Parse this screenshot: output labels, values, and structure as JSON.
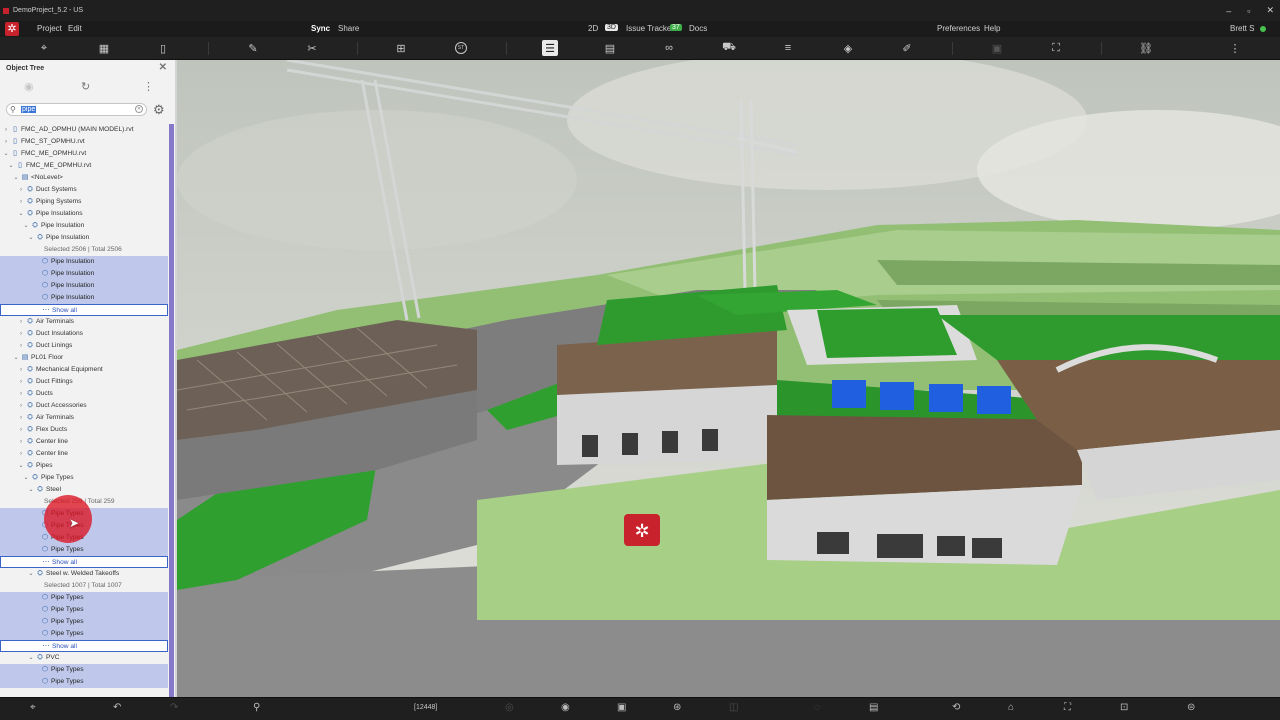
{
  "window": {
    "title": "DemoProject_5.2 - US",
    "controls": [
      "–",
      "▫",
      "✕"
    ]
  },
  "menubar": {
    "left": [
      "Project",
      "Edit"
    ],
    "sync": "Sync",
    "share": "Share",
    "view_2d": "2D",
    "view_3d": "3D",
    "issue_tracker": "Issue Tracker",
    "issue_count": "37",
    "docs": "Docs",
    "preferences": "Preferences",
    "help": "Help",
    "user": "Brett S"
  },
  "toolbar": {
    "icons": [
      "location-pin-icon",
      "map-icon",
      "mobile-icon",
      "ruler-icon",
      "scissors-icon",
      "add-square-icon",
      "st-circle-icon",
      "object-tree-icon",
      "list-icon",
      "binoculars-icon",
      "filter-truck-icon",
      "sort-list-icon",
      "paint-bucket-icon",
      "edit-doc-icon",
      "layers-icon",
      "drone-icon",
      "link-icon",
      "more-icon"
    ],
    "st_label": "ST",
    "active": "object-tree-icon"
  },
  "panel": {
    "title": "Object Tree",
    "search_value": "pipe",
    "tree": [
      {
        "label": "FMC_AD_OPMHU (MAIN MODEL).rvt",
        "indent": 0,
        "chev": "›",
        "icon": "file"
      },
      {
        "label": "FMC_ST_OPMHU.rvt",
        "indent": 0,
        "chev": "›",
        "icon": "file"
      },
      {
        "label": "FMC_ME_OPMHU.rvt",
        "indent": 0,
        "chev": "⌄",
        "icon": "file"
      },
      {
        "label": "FMC_ME_OPMHU.rvt",
        "indent": 1,
        "chev": "⌄",
        "icon": "doc"
      },
      {
        "label": "<NoLevel>",
        "indent": 2,
        "chev": "⌄",
        "icon": "level"
      },
      {
        "label": "Duct Systems",
        "indent": 3,
        "chev": "›",
        "icon": "type"
      },
      {
        "label": "Piping Systems",
        "indent": 3,
        "chev": "›",
        "icon": "type"
      },
      {
        "label": "Pipe Insulations",
        "indent": 3,
        "chev": "⌄",
        "icon": "type"
      },
      {
        "label": "Pipe Insulation",
        "indent": 4,
        "chev": "⌄",
        "icon": "type"
      },
      {
        "label": "Pipe Insulation",
        "indent": 5,
        "chev": "⌄",
        "icon": "type"
      },
      {
        "label": "Selected 2506 | Total 2506",
        "indent": 6,
        "kind": "selinfo"
      },
      {
        "label": "Pipe Insulation",
        "indent": 6,
        "kind": "hl",
        "icon": "cube"
      },
      {
        "label": "Pipe Insulation",
        "indent": 6,
        "kind": "hl",
        "icon": "cube"
      },
      {
        "label": "Pipe Insulation",
        "indent": 6,
        "kind": "hl",
        "icon": "cube"
      },
      {
        "label": "Pipe Insulation",
        "indent": 6,
        "kind": "hl",
        "icon": "cube"
      },
      {
        "label": "Show all",
        "indent": 6,
        "kind": "showall",
        "icon": "dots"
      },
      {
        "label": "Air Terminals",
        "indent": 3,
        "chev": "›",
        "icon": "type"
      },
      {
        "label": "Duct Insulations",
        "indent": 3,
        "chev": "›",
        "icon": "type"
      },
      {
        "label": "Duct Linings",
        "indent": 3,
        "chev": "›",
        "icon": "type"
      },
      {
        "label": "PL01 Floor",
        "indent": 2,
        "chev": "⌄",
        "icon": "level"
      },
      {
        "label": "Mechanical Equipment",
        "indent": 3,
        "chev": "›",
        "icon": "type"
      },
      {
        "label": "Duct Fittings",
        "indent": 3,
        "chev": "›",
        "icon": "type"
      },
      {
        "label": "Ducts",
        "indent": 3,
        "chev": "›",
        "icon": "type"
      },
      {
        "label": "Duct Accessories",
        "indent": 3,
        "chev": "›",
        "icon": "type"
      },
      {
        "label": "Air Terminals",
        "indent": 3,
        "chev": "›",
        "icon": "type"
      },
      {
        "label": "Flex Ducts",
        "indent": 3,
        "chev": "›",
        "icon": "type"
      },
      {
        "label": "Center line",
        "indent": 3,
        "chev": "›",
        "icon": "type"
      },
      {
        "label": "Center line",
        "indent": 3,
        "chev": "›",
        "icon": "type"
      },
      {
        "label": "Pipes",
        "indent": 3,
        "chev": "⌄",
        "icon": "type"
      },
      {
        "label": "Pipe Types",
        "indent": 4,
        "chev": "⌄",
        "icon": "type"
      },
      {
        "label": "Steel",
        "indent": 5,
        "chev": "⌄",
        "icon": "type"
      },
      {
        "label": "Selected 259 | Total 259",
        "indent": 6,
        "kind": "selinfo"
      },
      {
        "label": "Pipe Types",
        "indent": 6,
        "kind": "hl",
        "icon": "cube"
      },
      {
        "label": "Pipe Types",
        "indent": 6,
        "kind": "hl",
        "icon": "cube"
      },
      {
        "label": "Pipe Types",
        "indent": 6,
        "kind": "hl",
        "icon": "cube"
      },
      {
        "label": "Pipe Types",
        "indent": 6,
        "kind": "hl",
        "icon": "cube"
      },
      {
        "label": "Show all",
        "indent": 6,
        "kind": "showall",
        "icon": "dots"
      },
      {
        "label": "Steel w. Welded Takeoffs",
        "indent": 5,
        "chev": "⌄",
        "icon": "type"
      },
      {
        "label": "Selected 1007 | Total 1007",
        "indent": 6,
        "kind": "selinfo"
      },
      {
        "label": "Pipe Types",
        "indent": 6,
        "kind": "hl",
        "icon": "cube"
      },
      {
        "label": "Pipe Types",
        "indent": 6,
        "kind": "hl",
        "icon": "cube"
      },
      {
        "label": "Pipe Types",
        "indent": 6,
        "kind": "hl",
        "icon": "cube"
      },
      {
        "label": "Pipe Types",
        "indent": 6,
        "kind": "hl",
        "icon": "cube"
      },
      {
        "label": "Show all",
        "indent": 6,
        "kind": "showall",
        "icon": "dots"
      },
      {
        "label": "PVC",
        "indent": 5,
        "chev": "⌄",
        "icon": "type"
      },
      {
        "label": "Pipe Types",
        "indent": 6,
        "kind": "hl",
        "icon": "cube"
      },
      {
        "label": "Pipe Types",
        "indent": 6,
        "kind": "hl",
        "icon": "cube"
      }
    ]
  },
  "bottombar": {
    "count": "[12448]"
  },
  "colors": {
    "accent": "#c8232c",
    "highlight": "#bfc8ea",
    "scroll": "#8779c9",
    "grass": "#8fc46a",
    "roof": "#2f9b2f"
  }
}
